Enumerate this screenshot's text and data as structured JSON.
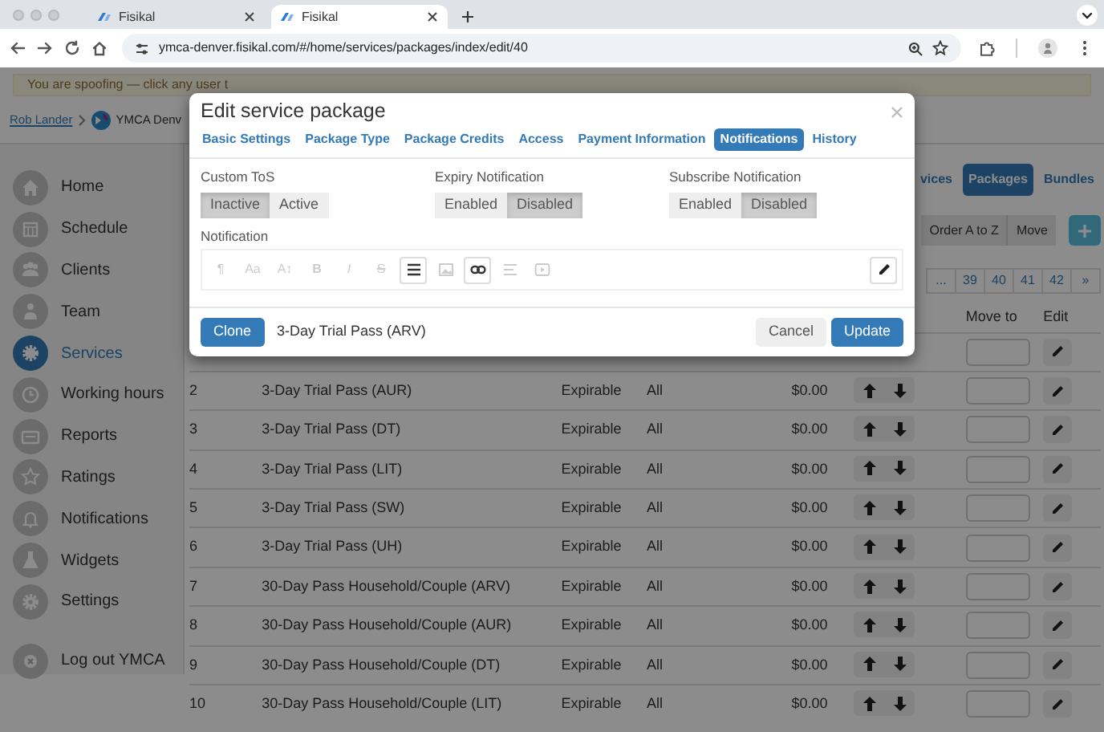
{
  "browser": {
    "tabs": [
      {
        "title": "Fisikal",
        "selected": false
      },
      {
        "title": "Fisikal",
        "selected": true
      }
    ],
    "url": "ymca-denver.fisikal.com/#/home/services/packages/index/edit/40"
  },
  "banner": {
    "text": "You are spoofing — click any user t"
  },
  "breadcrumb": {
    "user": "Rob Lander",
    "account": "YMCA Denv"
  },
  "sidebar": {
    "items": [
      {
        "label": "Home",
        "selected": false
      },
      {
        "label": "Schedule",
        "selected": false
      },
      {
        "label": "Clients",
        "selected": false
      },
      {
        "label": "Team",
        "selected": false
      },
      {
        "label": "Services",
        "selected": true
      },
      {
        "label": "Working hours",
        "selected": false
      },
      {
        "label": "Reports",
        "selected": false
      },
      {
        "label": "Ratings",
        "selected": false
      },
      {
        "label": "Notifications",
        "selected": false
      },
      {
        "label": "Widgets",
        "selected": false
      },
      {
        "label": "Settings",
        "selected": false
      }
    ],
    "logout": "Log out YMCA"
  },
  "section_tabs": [
    {
      "label": "vices",
      "selected": false
    },
    {
      "label": "Packages",
      "selected": true
    },
    {
      "label": "Bundles",
      "selected": false
    }
  ],
  "toolbar": {
    "buttons": [
      "Order A to Z",
      "Move"
    ]
  },
  "pagination": [
    "...",
    "39",
    "40",
    "41",
    "42",
    "»"
  ],
  "table": {
    "columns": {
      "move_to": "Move to",
      "edit": "Edit"
    },
    "rows": [
      {},
      {
        "number": "2",
        "name": "3-Day Trial Pass (AUR)",
        "type": "Expirable",
        "locations": "All",
        "price": "$0.00"
      },
      {
        "number": "3",
        "name": "3-Day Trial Pass (DT)",
        "type": "Expirable",
        "locations": "All",
        "price": "$0.00"
      },
      {
        "number": "4",
        "name": "3-Day Trial Pass (LIT)",
        "type": "Expirable",
        "locations": "All",
        "price": "$0.00"
      },
      {
        "number": "5",
        "name": "3-Day Trial Pass (SW)",
        "type": "Expirable",
        "locations": "All",
        "price": "$0.00"
      },
      {
        "number": "6",
        "name": "3-Day Trial Pass (UH)",
        "type": "Expirable",
        "locations": "All",
        "price": "$0.00"
      },
      {
        "number": "7",
        "name": "30-Day Pass Household/Couple (ARV)",
        "type": "Expirable",
        "locations": "All",
        "price": "$0.00"
      },
      {
        "number": "8",
        "name": "30-Day Pass Household/Couple (AUR)",
        "type": "Expirable",
        "locations": "All",
        "price": "$0.00"
      },
      {
        "number": "9",
        "name": "30-Day Pass Household/Couple (DT)",
        "type": "Expirable",
        "locations": "All",
        "price": "$0.00"
      },
      {
        "number": "10",
        "name": "30-Day Pass Household/Couple (LIT)",
        "type": "Expirable",
        "locations": "All",
        "price": "$0.00"
      }
    ]
  },
  "dialog": {
    "title": "Edit service package",
    "tabs": [
      {
        "label": "Basic Settings",
        "selected": false
      },
      {
        "label": "Package Type",
        "selected": false
      },
      {
        "label": "Package Credits",
        "selected": false
      },
      {
        "label": "Access",
        "selected": false
      },
      {
        "label": "Payment Information",
        "selected": false
      },
      {
        "label": "Notifications",
        "selected": true
      },
      {
        "label": "History",
        "selected": false
      }
    ],
    "toggles": [
      {
        "label": "Custom ToS",
        "options": [
          {
            "label": "Inactive",
            "selected": true
          },
          {
            "label": "Active",
            "selected": false
          }
        ]
      },
      {
        "label": "Expiry Notification",
        "options": [
          {
            "label": "Enabled",
            "selected": false
          },
          {
            "label": "Disabled",
            "selected": true
          }
        ]
      },
      {
        "label": "Subscribe Notification",
        "options": [
          {
            "label": "Enabled",
            "selected": false
          },
          {
            "label": "Disabled",
            "selected": true
          }
        ]
      }
    ],
    "notification": {
      "label": "Notification",
      "tools": [
        {
          "kind": "text",
          "label": "¶",
          "enabled": false
        },
        {
          "kind": "text",
          "label": "Aa",
          "enabled": false
        },
        {
          "kind": "text",
          "label": "A↕",
          "enabled": false
        },
        {
          "kind": "bold",
          "label": "B",
          "enabled": false
        },
        {
          "kind": "italic",
          "label": "I",
          "enabled": false
        },
        {
          "kind": "strike",
          "label": "S",
          "enabled": false
        },
        {
          "kind": "list",
          "enabled": true
        },
        {
          "kind": "image",
          "enabled": false
        },
        {
          "kind": "link",
          "enabled": true
        },
        {
          "kind": "align",
          "enabled": false
        },
        {
          "kind": "video",
          "enabled": false
        }
      ]
    },
    "package_name": "3-Day Trial Pass (ARV)",
    "buttons": {
      "clone": "Clone",
      "cancel": "Cancel",
      "update": "Update"
    }
  }
}
